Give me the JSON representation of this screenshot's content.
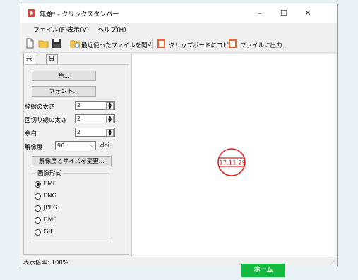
{
  "window": {
    "title": "無題* - クリックスタンパー",
    "min": "–",
    "max": "☐",
    "close": "✕"
  },
  "menu": [
    "ファイル(F)",
    "表示(V)",
    "ヘルプ(H)"
  ],
  "toolbar": {
    "recent": "最近使ったファイルを開く..",
    "copy": "クリップボードにコピー",
    "export": "ファイルに出力.."
  },
  "tabs": [
    "共通",
    "日付印"
  ],
  "panel": {
    "color_button": "色...",
    "font_button": "フォント...",
    "border_width_label": "枠線の太さ",
    "border_width_value": "2",
    "divider_width_label": "区切り線の太さ",
    "divider_width_value": "2",
    "margin_label": "余白",
    "margin_value": "2",
    "resolution_label": "解像度",
    "resolution_value": "96",
    "resolution_unit": "dpi",
    "resize_button": "解像度とサイズを変更...",
    "format_group_title": "画像形式",
    "formats": [
      "EMF",
      "PNG",
      "JPEG",
      "BMP",
      "GIF"
    ],
    "selected_format": "EMF"
  },
  "stamp": {
    "date": "'17.11.29",
    "color": "#e02020"
  },
  "status": {
    "zoom": "表示倍率: 100%"
  },
  "home_button": "ホーム"
}
